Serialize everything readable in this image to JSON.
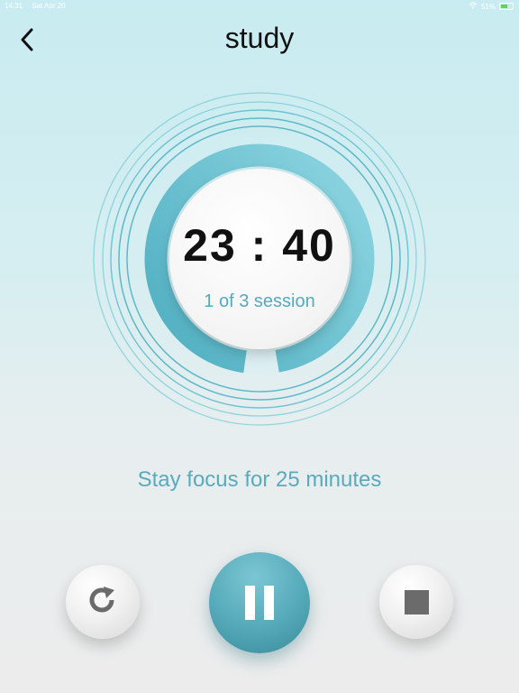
{
  "status_bar": {
    "time": "14:31",
    "date": "Sat Apr 20",
    "battery": "51%"
  },
  "header": {
    "title": "study"
  },
  "timer": {
    "time": "23 : 40",
    "session": "1 of 3 session",
    "progress_fraction": 0.95
  },
  "focus_message": "Stay focus for 25 minutes",
  "icons": {
    "back": "chevron-left-icon",
    "restart": "refresh-icon",
    "pause": "pause-icon",
    "stop": "stop-icon",
    "wifi": "wifi-icon",
    "battery": "battery-icon"
  },
  "colors": {
    "accent": "#56a9bd",
    "ring": "#6cc3d3",
    "pause_button": "#54a9b8",
    "title": "#111111"
  }
}
